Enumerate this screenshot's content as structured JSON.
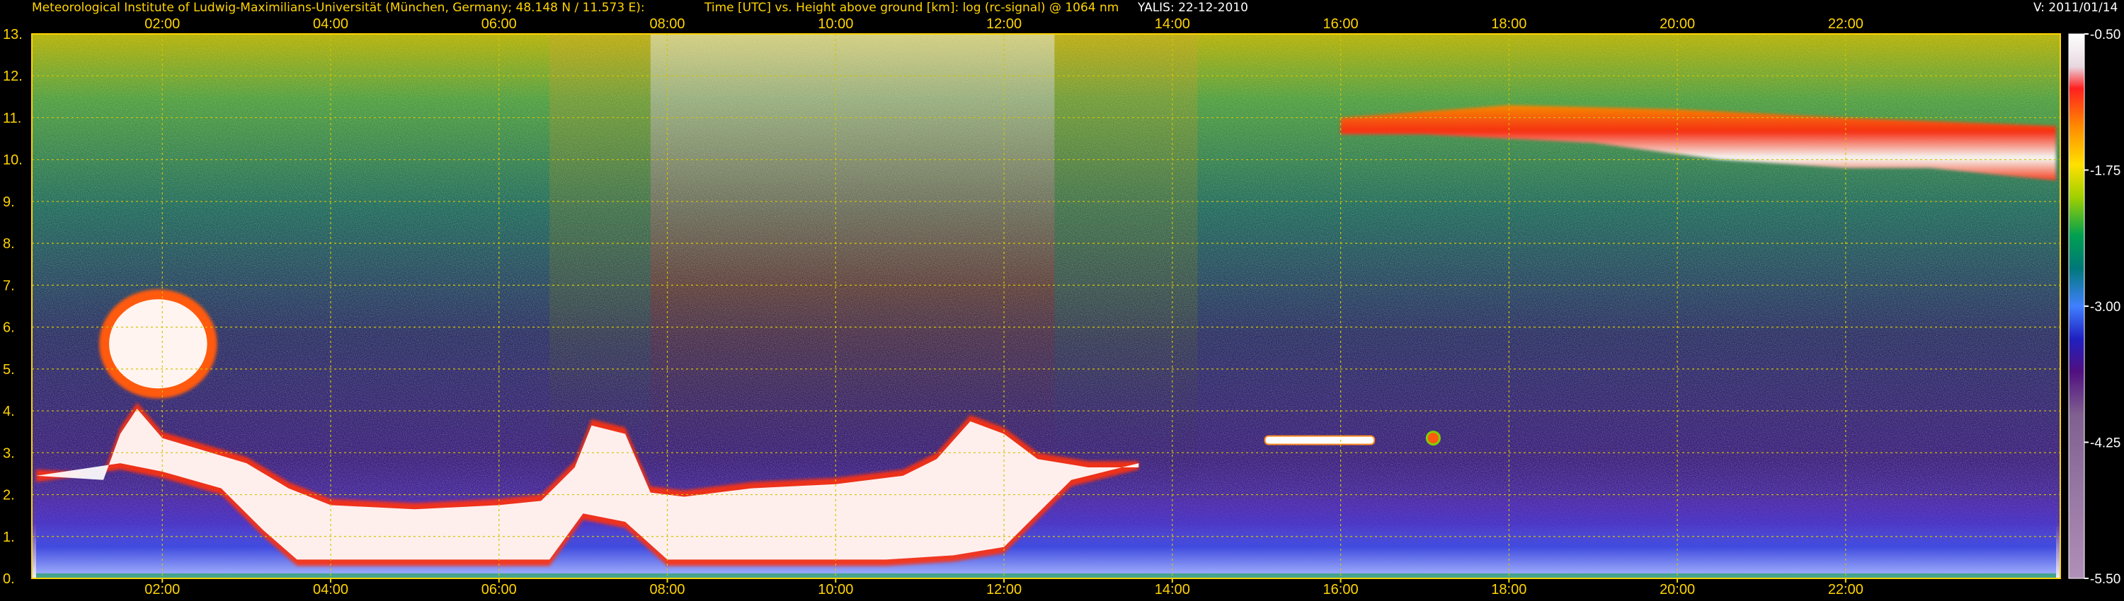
{
  "header": {
    "institute": "Meteorological Institute of Ludwig-Maximilians-Universität (München, Germany; 48.148 N / 11.573 E):",
    "axis_title": "Time [UTC] vs. Height above ground [km]: log (rc-signal) @ 1064 nm",
    "instrument_date": "YALIS: 22-12-2010",
    "version": "V: 2011/01/14"
  },
  "chart_data": {
    "type": "heatmap",
    "title": "Time [UTC] vs. Height above ground [km]: log (rc-signal) @ 1064 nm",
    "x_ticks": [
      "02:00",
      "04:00",
      "06:00",
      "08:00",
      "10:00",
      "12:00",
      "14:00",
      "16:00",
      "18:00",
      "20:00",
      "22:00"
    ],
    "x_tick_hours": [
      2,
      4,
      6,
      8,
      10,
      12,
      14,
      16,
      18,
      20,
      22
    ],
    "xlim_hours": [
      0.45,
      24.55
    ],
    "y_ticks": [
      "0.",
      "1.",
      "2.",
      "3.",
      "4.",
      "5.",
      "6.",
      "7.",
      "8.",
      "9.",
      "10.",
      "11.",
      "12.",
      "13."
    ],
    "ylim_km": [
      0,
      13
    ],
    "grid": true,
    "colorbar": {
      "labels": [
        "-0.50",
        "-1.75",
        "-3.00",
        "-4.25",
        "-5.50"
      ],
      "values": [
        -0.5,
        -1.75,
        -3.0,
        -4.25,
        -5.5
      ],
      "range": [
        -5.5,
        -0.5
      ]
    },
    "colors": {
      "grid": "#d4c400",
      "text": "#ffd400",
      "frame": "#ffd400"
    },
    "features": [
      {
        "name": "boundary-layer aerosol",
        "start_h": 0.5,
        "end_h": 24.5,
        "top_km": 1.9
      },
      {
        "name": "low cloud layer",
        "start_h": 0.5,
        "end_h": 13.6,
        "base_km": 0.3,
        "top_km": 3.5
      },
      {
        "name": "mid cloud 01-02 UTC",
        "start_h": 1.3,
        "end_h": 2.6,
        "base_km": 4.4,
        "top_km": 6.8
      },
      {
        "name": "thin cloud near 15 UTC",
        "start_h": 15.1,
        "end_h": 16.4,
        "base_km": 3.2,
        "top_km": 3.4
      },
      {
        "name": "cirrus",
        "start_h": 16.0,
        "end_h": 24.5,
        "base_km": 9.5,
        "top_km": 11.3
      }
    ]
  }
}
